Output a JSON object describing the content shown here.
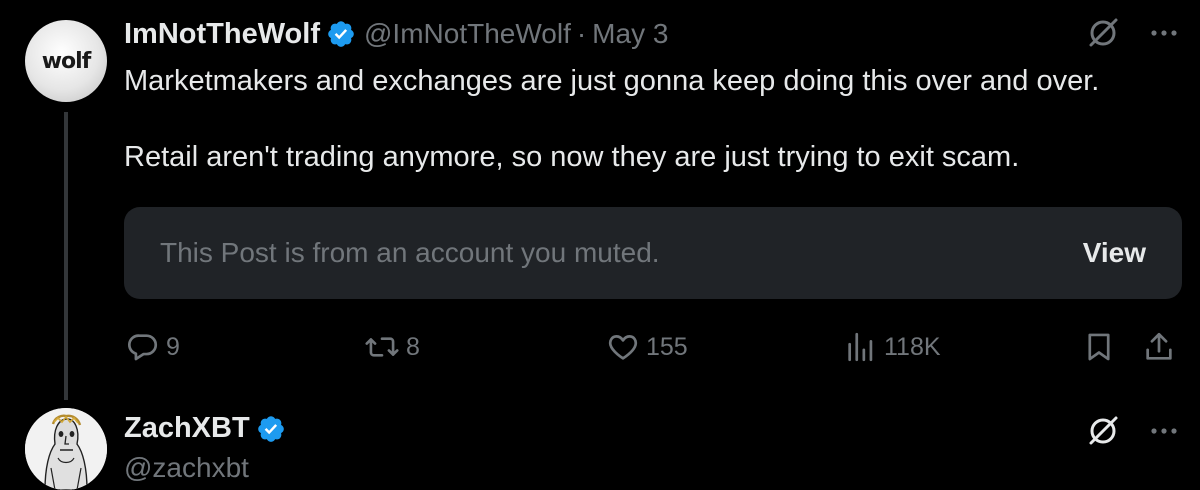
{
  "tweet": {
    "author_name": "ImNotTheWolf",
    "avatar_text": "wolf",
    "handle": "@ImNotTheWolf",
    "separator": "·",
    "date": "May 3",
    "text_line1": "Marketmakers and exchanges are just gonna keep doing this over and over.",
    "text_line2": "Retail aren't trading anymore, so now they are just trying to exit scam.",
    "muted_notice": "This Post is from an account you muted.",
    "view_label": "View",
    "stats": {
      "replies": "9",
      "reposts": "8",
      "likes": "155",
      "views": "118K"
    }
  },
  "reply": {
    "author_name": "ZachXBT",
    "handle": "@zachxbt"
  },
  "colors": {
    "background": "#000000",
    "text": "#e7e9ea",
    "secondary": "#71767b",
    "verified": "#1d9bf0",
    "muted_box": "#202327"
  },
  "icons": [
    "verified-badge-icon",
    "grok-icon",
    "more-icon",
    "reply-icon",
    "repost-icon",
    "like-icon",
    "views-icon",
    "bookmark-icon",
    "share-icon"
  ]
}
